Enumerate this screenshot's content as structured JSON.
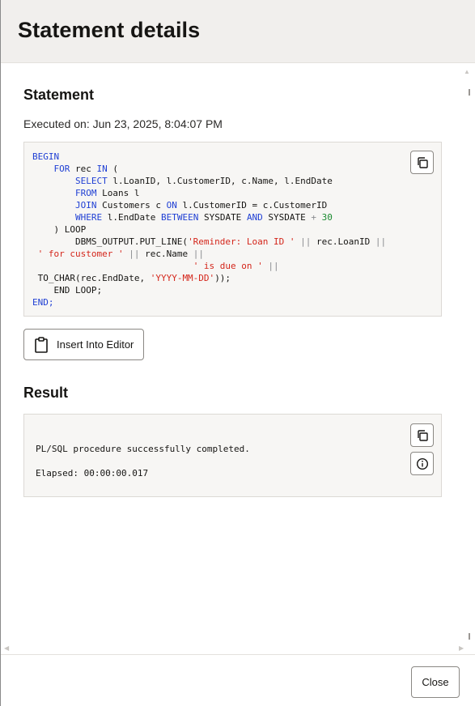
{
  "dialog": {
    "title": "Statement details",
    "close_label": "Close"
  },
  "statement": {
    "heading": "Statement",
    "executed_on": "Executed on: Jun 23, 2025, 8:04:07 PM",
    "code_lines": [
      "BEGIN",
      "    FOR rec IN (",
      "        SELECT l.LoanID, l.CustomerID, c.Name, l.EndDate",
      "        FROM Loans l",
      "        JOIN Customers c ON l.CustomerID = c.CustomerID",
      "        WHERE l.EndDate BETWEEN SYSDATE AND SYSDATE + 30",
      "    ) LOOP",
      "        DBMS_OUTPUT.PUT_LINE('Reminder: Loan ID ' || rec.LoanID ||",
      " ' for customer ' || rec.Name ||",
      "                              ' is due on ' ||",
      " TO_CHAR(rec.EndDate, 'YYYY-MM-DD'));",
      "    END LOOP;",
      "END;"
    ],
    "copy_icon": "copy-icon",
    "insert_label": "Insert Into Editor",
    "insert_icon": "clipboard-icon"
  },
  "result": {
    "heading": "Result",
    "lines": [
      "PL/SQL procedure successfully completed.",
      "",
      "Elapsed: 00:00:00.017"
    ],
    "copy_icon": "copy-icon",
    "info_icon": "info-icon"
  },
  "colors": {
    "keyword": "#1f3fd4",
    "string": "#d4261b",
    "number": "#1a8a2f",
    "operator": "#8a8c90",
    "header_bg": "#f1efed",
    "code_bg": "#f7f6f4"
  }
}
